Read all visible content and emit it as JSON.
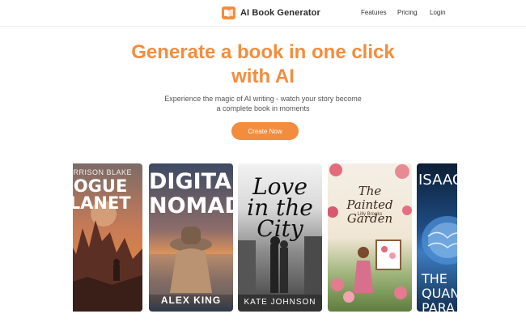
{
  "header": {
    "brand": "AI Book Generator",
    "logo_icon": "open-book-icon",
    "nav": [
      "Features",
      "Pricing",
      "Login"
    ]
  },
  "hero": {
    "title": "Generate a book in one click\nwith AI",
    "subtitle": "Experience the magic of AI writing - watch your story become\na complete book in moments",
    "cta": "Create Now"
  },
  "books": [
    {
      "author": "HARRISON BLAKE",
      "title": "ROGUE\nPLANET"
    },
    {
      "title": "DIGITAL\nNOMAD",
      "author": "ALEX KING"
    },
    {
      "title": "Love\nin the\nCity",
      "author": "KATE JOHNSON"
    },
    {
      "title": "The\nPainted\nGarden",
      "author": "Lilly Brooks"
    },
    {
      "title": "ISAAC",
      "title2": "THE\nQUAN\nPARA"
    }
  ],
  "colors": {
    "accent": "#f38d3e",
    "text": "#333333"
  }
}
